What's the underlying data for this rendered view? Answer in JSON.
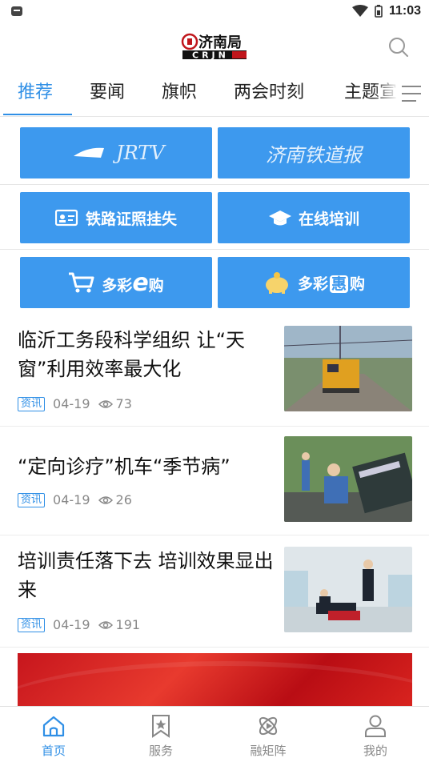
{
  "status_bar": {
    "time": "11:03"
  },
  "header": {
    "logo_text": "济南局",
    "logo_sub": "CRJN"
  },
  "tabs": [
    {
      "label": "推荐",
      "active": true
    },
    {
      "label": "要闻",
      "active": false
    },
    {
      "label": "旗帜",
      "active": false
    },
    {
      "label": "两会时刻",
      "active": false
    },
    {
      "label": "主题宣",
      "active": false
    }
  ],
  "services": [
    {
      "label": "JRTV",
      "icon": "jrtv-logo"
    },
    {
      "label": "济南铁道报",
      "icon": "newspaper-logo"
    },
    {
      "label": "铁路证照挂失",
      "icon": "id-card-icon"
    },
    {
      "label": "在线培训",
      "icon": "graduation-cap-icon"
    },
    {
      "label_pre": "多彩",
      "label_em": "e",
      "label_post": "购",
      "icon": "cart-icon"
    },
    {
      "label_pre": "多彩",
      "label_em": "惠",
      "label_post": "购",
      "icon": "piggy-bank-icon"
    }
  ],
  "news": [
    {
      "title": "临沂工务段科学组织 让“天窗”利用效率最大化",
      "tag": "资讯",
      "date": "04-19",
      "views": "73"
    },
    {
      "title": "“定向诊疗”机车“季节病”",
      "tag": "资讯",
      "date": "04-19",
      "views": "26"
    },
    {
      "title": "培训责任落下去 培训效果显出来",
      "tag": "资讯",
      "date": "04-19",
      "views": "191"
    }
  ],
  "bottom_nav": [
    {
      "label": "首页",
      "icon": "home-icon",
      "active": true
    },
    {
      "label": "服务",
      "icon": "bookmark-star-icon",
      "active": false
    },
    {
      "label": "融矩阵",
      "icon": "atom-icon",
      "active": false
    },
    {
      "label": "我的",
      "icon": "user-icon",
      "active": false
    }
  ],
  "colors": {
    "accent": "#2f8fe6",
    "tile": "#3d99ee",
    "banner_red": "#c7161d"
  }
}
